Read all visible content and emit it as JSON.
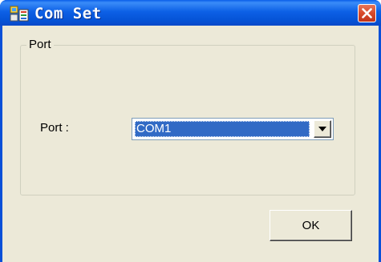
{
  "window": {
    "title": "Com Set",
    "icon": "app-window-icon",
    "close_icon": "close-icon"
  },
  "port_group": {
    "label": "Port",
    "field_label": "Port :",
    "selected_port": "COM1",
    "dropdown_icon": "chevron-down-icon"
  },
  "buttons": {
    "ok_label": "OK"
  },
  "colors": {
    "titlebar": "#0553d6",
    "client_bg": "#ece9d8",
    "selection": "#316ac5",
    "close_button": "#d84a2a"
  }
}
